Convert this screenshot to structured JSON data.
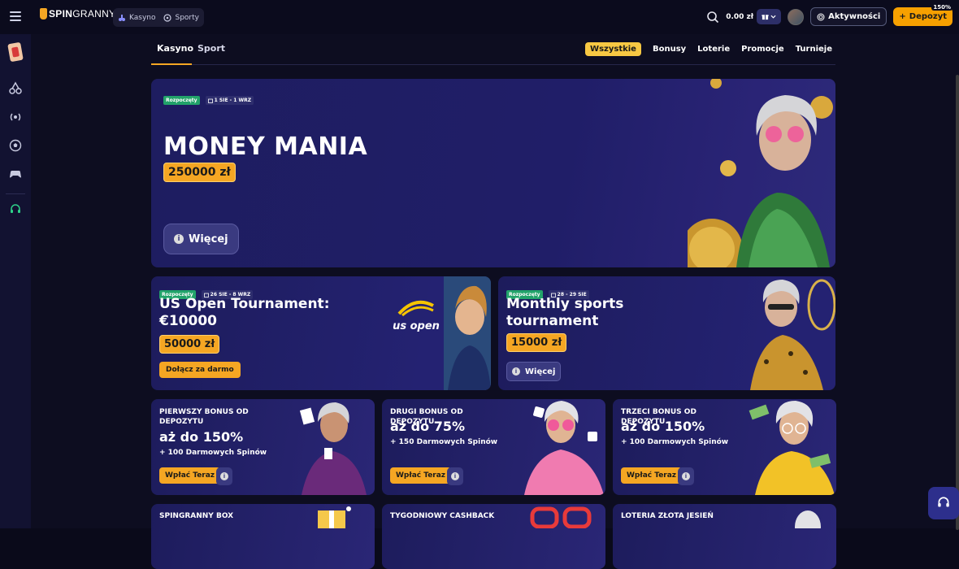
{
  "brand": {
    "spin": "SPIN",
    "granny": "GRANNY"
  },
  "topnav": [
    {
      "label": "Kasyno",
      "icon": "casino-icon"
    },
    {
      "label": "Sporty",
      "icon": "sports-icon"
    }
  ],
  "header": {
    "balance": "0.00 zł",
    "activity_label": "Aktywności",
    "deposit_label": "Depozyt",
    "deposit_badge": "150%"
  },
  "tabs": [
    {
      "label": "Kasyno",
      "active": true
    },
    {
      "label": "Sport",
      "active": false
    }
  ],
  "filters": [
    "Wszystkie",
    "Bonusy",
    "Loterie",
    "Promocje",
    "Turnieje"
  ],
  "hero": {
    "status": "Rozpoczęty",
    "dates": "1 SIE - 1 WRZ",
    "title": "MONEY MANIA",
    "prize": "250000 zł",
    "more_label": "Więcej"
  },
  "tournaments": [
    {
      "status": "Rozpoczęty",
      "dates": "26 SIE - 8 WRZ",
      "title_line1": "US Open Tournament:",
      "title_line2": "€10000",
      "prize": "50000 zł",
      "button": "Dołącz za darmo",
      "logo_text": "us open"
    },
    {
      "status": "Rozpoczęty",
      "dates": "28 - 29 SIE",
      "title_line1": "Monthly sports",
      "title_line2": "tournament",
      "prize": "15000 zł",
      "button": "Więcej"
    }
  ],
  "bonuses": [
    {
      "head": "PIERWSZY BONUS OD DEPOZYTU",
      "big": "aż do 150%",
      "sub": "+ 100 Darmowych Spinów",
      "button": "Wpłać Teraz"
    },
    {
      "head": "DRUGI BONUS OD DEPOZYTU",
      "big": "aż do 75%",
      "sub": "+ 150 Darmowych Spinów",
      "button": "Wpłać Teraz"
    },
    {
      "head": "TRZECI BONUS OD DEPOZYTU",
      "big": "aż do 150%",
      "sub": "+ 100 Darmowych Spinów",
      "button": "Wpłać Teraz"
    }
  ],
  "bottom_cards": [
    {
      "head": "SPINGRANNY BOX"
    },
    {
      "head": "TYGODNIOWY CASHBACK"
    },
    {
      "head": "LOTERIA ZŁOTA JESIEŃ"
    }
  ],
  "colors": {
    "accent": "#f5a623",
    "chip_active": "#f7c843",
    "status_green": "#22a36a",
    "card_bg": "#1e1d60",
    "page_bg": "#0d0d20"
  }
}
